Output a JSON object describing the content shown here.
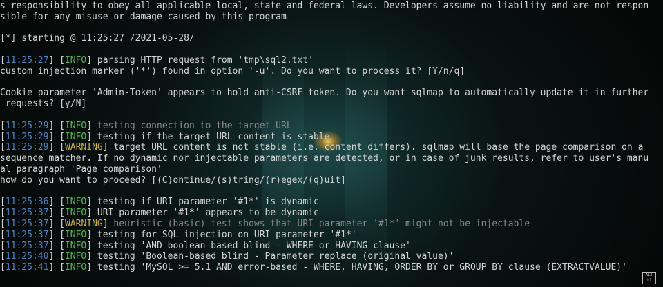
{
  "lines": [
    {
      "type": "plain",
      "text": "s responsibility to obey all applicable local, state and federal laws. Developers assume no liability and are not respon"
    },
    {
      "type": "plain",
      "text": "sible for any misuse or damage caused by this program"
    },
    {
      "type": "blank"
    },
    {
      "type": "plain",
      "text": "[*] starting @ 11:25:27 /2021-05-28/"
    },
    {
      "type": "blank"
    },
    {
      "type": "log",
      "time": "11:25:27",
      "level": "INFO",
      "msg": " parsing HTTP request from 'tmp\\sql2.txt'"
    },
    {
      "type": "plain",
      "text": "custom injection marker ('*') found in option '-u'. Do you want to process it? [Y/n/q]"
    },
    {
      "type": "blank"
    },
    {
      "type": "plain",
      "text": "Cookie parameter 'Admin-Token' appears to hold anti-CSRF token. Do you want sqlmap to automatically update it in further"
    },
    {
      "type": "plain",
      "text": " requests? [y/N]"
    },
    {
      "type": "blank"
    },
    {
      "type": "log",
      "time": "11:25:29",
      "level": "INFO",
      "msg": " testing connection to the target URL",
      "dim": true
    },
    {
      "type": "log",
      "time": "11:25:29",
      "level": "INFO",
      "msg": " testing if the target URL content is stable"
    },
    {
      "type": "log",
      "time": "11:25:29",
      "level": "WARNING",
      "msg": " target URL content is not stable (i.e. content differs). sqlmap will base the page comparison on a"
    },
    {
      "type": "plain",
      "text": "sequence matcher. If no dynamic nor injectable parameters are detected, or in case of junk results, refer to user's manu"
    },
    {
      "type": "plain",
      "text": "al paragraph 'Page comparison'"
    },
    {
      "type": "plain",
      "text": "how do you want to proceed? [(C)ontinue/(s)tring/(r)egex/(q)uit]"
    },
    {
      "type": "blank"
    },
    {
      "type": "log",
      "time": "11:25:36",
      "level": "INFO",
      "msg": " testing if URI parameter '#1*' is dynamic"
    },
    {
      "type": "log",
      "time": "11:25:37",
      "level": "INFO",
      "msg": " URI parameter '#1*' appears to be dynamic"
    },
    {
      "type": "log",
      "time": "11:25:37",
      "level": "WARNING",
      "msg": " heuristic (basic) test shows that URI parameter '#1*' might not be injectable",
      "dim": true
    },
    {
      "type": "log",
      "time": "11:25:37",
      "level": "INFO",
      "msg": " testing for SQL injection on URI parameter '#1*'"
    },
    {
      "type": "log",
      "time": "11:25:37",
      "level": "INFO",
      "msg": " testing 'AND boolean-based blind - WHERE or HAVING clause'"
    },
    {
      "type": "log",
      "time": "11:25:40",
      "level": "INFO",
      "msg": " testing 'Boolean-based blind - Parameter replace (original value)'"
    },
    {
      "type": "log",
      "time": "11:25:41",
      "level": "INFO",
      "msg": " testing 'MySQL >= 5.1 AND error-based - WHERE, HAVING, ORDER BY or GROUP BY clause (EXTRACTVALUE)'"
    }
  ],
  "badge": {
    "top": "ALT",
    "bottom": "▯▯"
  },
  "colors": {
    "timestamp": "#4a88c8",
    "info": "#4fb84f",
    "warning": "#c9b336",
    "text": "#d4d4d4",
    "dim": "#8a8a8a"
  }
}
